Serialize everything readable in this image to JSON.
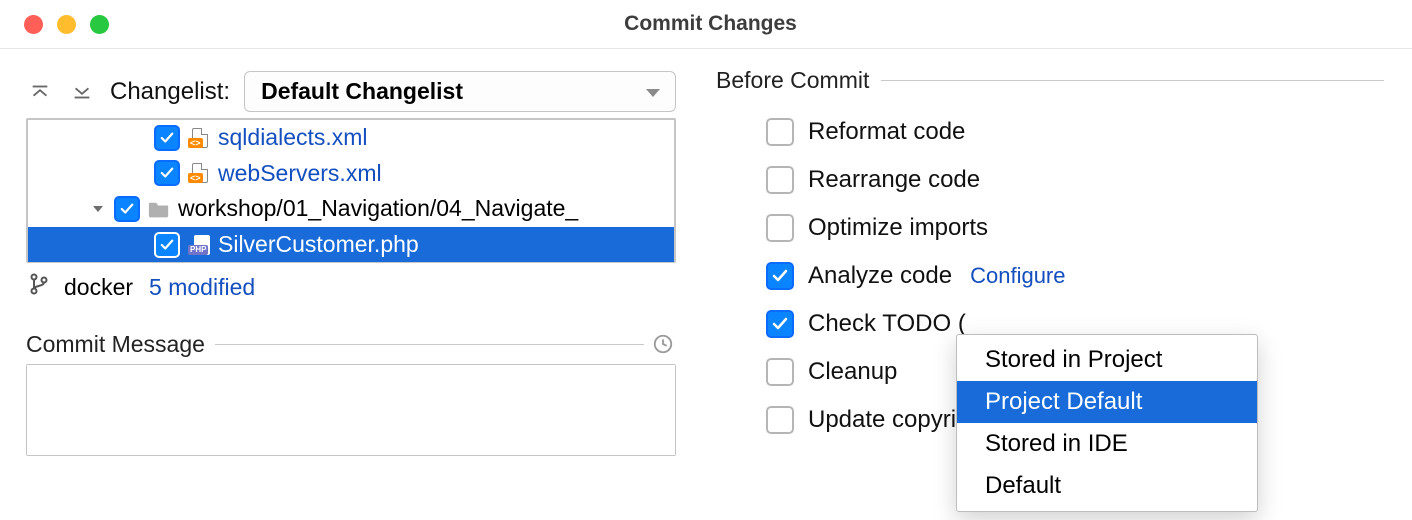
{
  "window": {
    "title": "Commit Changes"
  },
  "changelist": {
    "label": "Changelist:",
    "selected": "Default Changelist"
  },
  "tree": {
    "files": [
      {
        "name": "sqldialects.xml"
      },
      {
        "name": "webServers.xml"
      }
    ],
    "folder": {
      "name": "workshop/01_Navigation/04_Navigate_"
    },
    "selected_file": {
      "name": "SilverCustomer.php"
    }
  },
  "status": {
    "branch": "docker",
    "modified": "5 modified"
  },
  "commit_message": {
    "label": "Commit Message",
    "value": ""
  },
  "before_commit": {
    "heading": "Before Commit",
    "options": {
      "reformat": {
        "label": "Reformat code",
        "checked": false
      },
      "rearrange": {
        "label": "Rearrange code",
        "checked": false
      },
      "optimize": {
        "label": "Optimize imports",
        "checked": false
      },
      "analyze": {
        "label": "Analyze code",
        "checked": true,
        "link": "Configure"
      },
      "todo": {
        "label": "Check TODO (",
        "checked": true
      },
      "cleanup": {
        "label": "Cleanup",
        "checked": false
      },
      "copyright": {
        "label": "Update copyri",
        "checked": false
      }
    }
  },
  "popup": {
    "items": [
      "Stored in Project",
      "Project Default",
      "Stored in IDE",
      "Default"
    ],
    "selected_index": 1
  }
}
